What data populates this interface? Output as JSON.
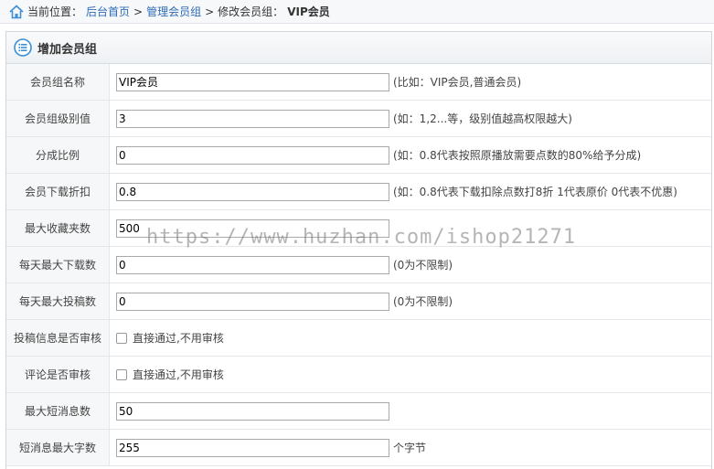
{
  "breadcrumb": {
    "prefix": "当前位置：",
    "home": "后台首页",
    "sep1": ">",
    "group": "管理会员组",
    "sep2": ">",
    "current_prefix": "修改会员组：",
    "current_name": "VIP会员"
  },
  "panel": {
    "title": "增加会员组"
  },
  "rows": [
    {
      "label": "会员组名称",
      "value": "VIP会员",
      "hint": "(比如：VIP会员,普通会员)"
    },
    {
      "label": "会员组级别值",
      "value": "3",
      "hint": "(如：1,2...等，级别值越高权限越大)"
    },
    {
      "label": "分成比例",
      "value": "0",
      "hint": "(如：0.8代表按照原播放需要点数的80%给予分成)"
    },
    {
      "label": "会员下载折扣",
      "value": "0.8",
      "hint": "(如：0.8代表下载扣除点数打8折 1代表原价 0代表不优惠)"
    },
    {
      "label": "最大收藏夹数",
      "value": "500",
      "hint": ""
    },
    {
      "label": "每天最大下载数",
      "value": "0",
      "hint": "(0为不限制)"
    },
    {
      "label": "每天最大投稿数",
      "value": "0",
      "hint": "(0为不限制)"
    },
    {
      "label": "投稿信息是否审核",
      "checkbox": "直接通过,不用审核"
    },
    {
      "label": "评论是否审核",
      "checkbox": "直接通过,不用审核"
    },
    {
      "label": "最大短消息数",
      "value": "50",
      "hint": ""
    },
    {
      "label": "短消息最大字数",
      "value": "255",
      "hint": "个字节"
    }
  ],
  "watermark": "https://www.huzhan.com/ishop21271",
  "colors": {
    "link": "#2d6bb5",
    "icon": "#3a8fd6"
  },
  "icons": {
    "home": "home-icon",
    "panel": "list-icon"
  }
}
